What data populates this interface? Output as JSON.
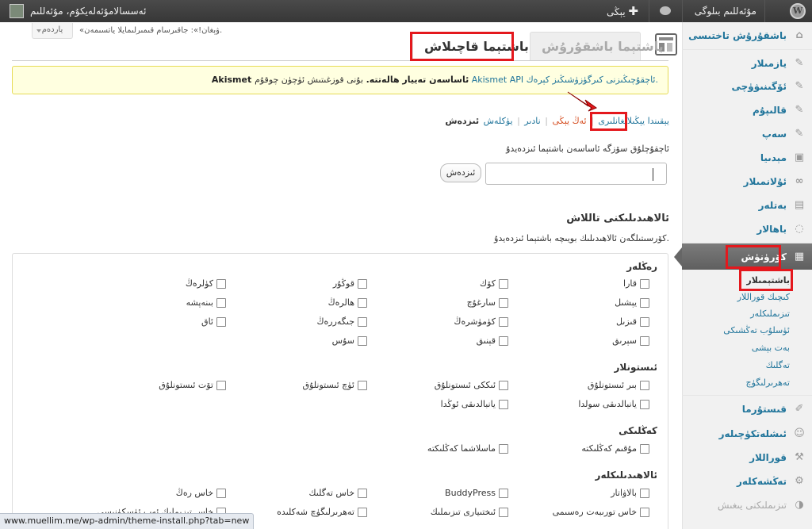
{
  "adminbar": {
    "site_name": "مۇئەللىم بىلوگى",
    "comments_icon": "comment-bubble-icon",
    "new_label": "يېڭى",
    "user_label": "ئەسسالامۇئەلەيكۇم، مۇئەللىم"
  },
  "header": {
    "screen_options": "ياردەم",
    "howdy_note": "«ۋېغان!»: جاقىرسام قىمىرلىمايلا ياتسىمەن.",
    "tab_installed": "باشتېما باشقۇرۇش",
    "tab_install": "باشتېما قاچىلاش"
  },
  "notice": {
    "strong": "Akismet ئاساسەن تەييار ھالەتتە.",
    "text": " بۇنى قوزغىتىش ئۈچۈن چوقۇم ",
    "link": "Akismet API ئاچقۇچىڭىزنى كىرگۈزۈشىڭىز كېرەك."
  },
  "filters": {
    "label": "ئىزدەش",
    "items": [
      "يۈكلەش",
      "نادىر",
      "ئەڭ يېڭى",
      "يېقىندا يېڭىلانغانلىرى"
    ]
  },
  "search": {
    "description": "ئاچقۇچلۇق سۆزگە ئاساسەن باشتېما ئىزدەيدۇ",
    "button": "ئىزدەش"
  },
  "feature_filter": {
    "title": "ئالاھىدىلىكنى تاللاش",
    "description": "كۆرسىتىلگەن ئالاھىدىلىك بويىچە باشتېما ئىزدەيدۇ.",
    "groups": [
      {
        "title": "رەڭلەر"
      },
      {
        "title": "ئىستونلار"
      },
      {
        "title": "كەڭلىكى"
      },
      {
        "title": "ئالاھىدىلىكلەر"
      }
    ],
    "colors": [
      [
        "قارا",
        "كۆك",
        "قوڭۇر",
        "كۈلرەڭ"
      ],
      [
        "يېشىل",
        "سارغۇچ",
        "ھالرەڭ",
        "بىنەپشە"
      ],
      [
        "قىزىل",
        "كۈمۈشرەڭ",
        "جىگەررەڭ",
        "ئاق"
      ],
      [
        "سېرىق",
        "قېنىق",
        "سۇس",
        ""
      ]
    ],
    "columns": [
      [
        "بىر ئىستونلۇق",
        "ئىككى ئىستونلۇق",
        "ئۈچ ئىستونلۇق",
        "تۆت ئىستونلۇق"
      ],
      [
        "يانبالدىقى سولدا",
        "يانبالدىقى ئوڭدا",
        "",
        ""
      ]
    ],
    "width": [
      "مۇقىم كەڭلىكتە",
      "ماسلاشما كەڭلىكتە"
    ],
    "features": [
      [
        "بالاۋاتار",
        "BuddyPress",
        "خاس تەگلىك",
        "خاس رەڭ"
      ],
      [
        "خاس تورىبەت رەسىمى",
        "ئىختىيارى تىزىملىك",
        "تەھرىرلىگۈچ شەكلىدە",
        "خاس تىزىملىك ئەپ ئۈسكۈنىسى"
      ]
    ]
  },
  "sidebar": {
    "items": [
      {
        "label": "باشقۇرۇش تاختىسى",
        "icon": "dashboard-icon"
      },
      {
        "label": "يازمىلار",
        "icon": "pushpin-icon"
      },
      {
        "label": "ئۆگىنىۋۈچى",
        "icon": "pushpin-icon"
      },
      {
        "label": "قالىپۇم",
        "icon": "pushpin-icon"
      },
      {
        "label": "سەپ",
        "icon": "pushpin-icon"
      },
      {
        "label": "مېدىيا",
        "icon": "media-icon"
      },
      {
        "label": "ئۇلانمىلار",
        "icon": "link-icon"
      },
      {
        "label": "بەتلەر",
        "icon": "pages-icon"
      },
      {
        "label": "باھالار",
        "icon": "comments-icon"
      },
      {
        "label": "كۆرۈنۈش",
        "icon": "appearance-icon"
      },
      {
        "label": "قىستۇرما",
        "icon": "plugins-icon"
      },
      {
        "label": "ئىشلەتكۈچىلەر",
        "icon": "users-icon"
      },
      {
        "label": "قوراللار",
        "icon": "tools-icon"
      },
      {
        "label": "تەڭشەكلەر",
        "icon": "settings-icon"
      },
      {
        "label": "تىزىملىكنى يىغىش",
        "icon": "collapse-icon"
      }
    ],
    "submenu": [
      "باشتېمىلار",
      "كىچىك قوراللار",
      "تىزىملىكلەر",
      "ئۈسلۇب تەڭشىكى",
      "بەت بېشى",
      "تەگلىك",
      "تەھرىرلىگۈچ"
    ]
  },
  "status_url": "www.muellim.me/wp-admin/theme-install.php?tab=new",
  "colors": {
    "accent": "#21759b",
    "highlight": "#e4181d",
    "notice_bg": "#ffffe0"
  }
}
